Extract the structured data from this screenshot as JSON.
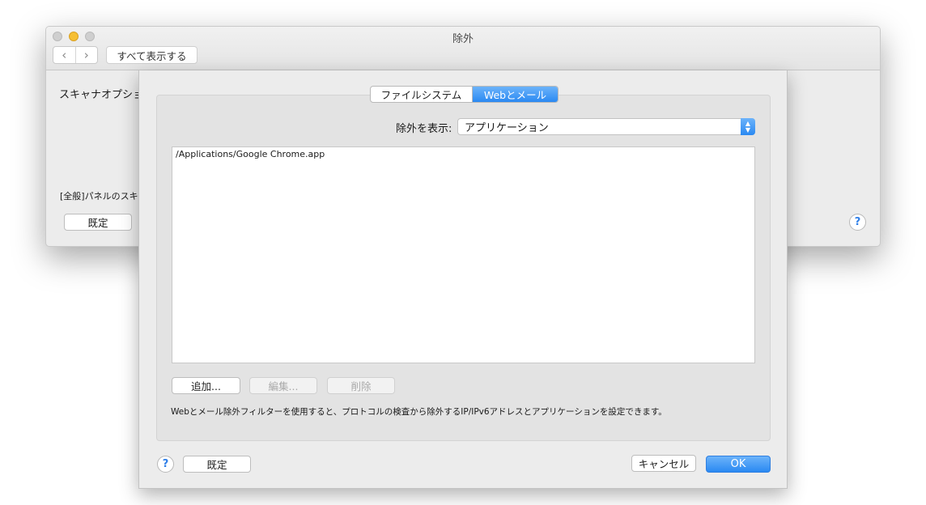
{
  "window": {
    "title": "除外",
    "show_all_label": "すべて表示する",
    "scanner_options_label": "スキャナオプショ",
    "general_panel_note": "[全般]パネルのスキャ",
    "default_button": "既定",
    "help_symbol": "?"
  },
  "sheet": {
    "tabs": [
      {
        "label": "ファイルシステム",
        "selected": false
      },
      {
        "label": "Webとメール",
        "selected": true
      }
    ],
    "filter_label": "除外を表示:",
    "filter_value": "アプリケーション",
    "exclusions": [
      "/Applications/Google Chrome.app"
    ],
    "buttons": {
      "add": "追加...",
      "edit": "編集...",
      "delete": "削除",
      "default": "既定",
      "cancel": "キャンセル",
      "ok": "OK"
    },
    "description": "Webとメール除外フィルターを使用すると、プロトコルの検査から除外するIP/IPv6アドレスとアプリケーションを設定できます。",
    "help_symbol": "?"
  },
  "colors": {
    "accent": "#2a89f2",
    "window_bg": "#ececec"
  },
  "icons": {
    "back": "chevron-left-icon",
    "forward": "chevron-right-icon",
    "select_arrows": "up-down-chevron-icon",
    "help": "question-mark-icon"
  }
}
